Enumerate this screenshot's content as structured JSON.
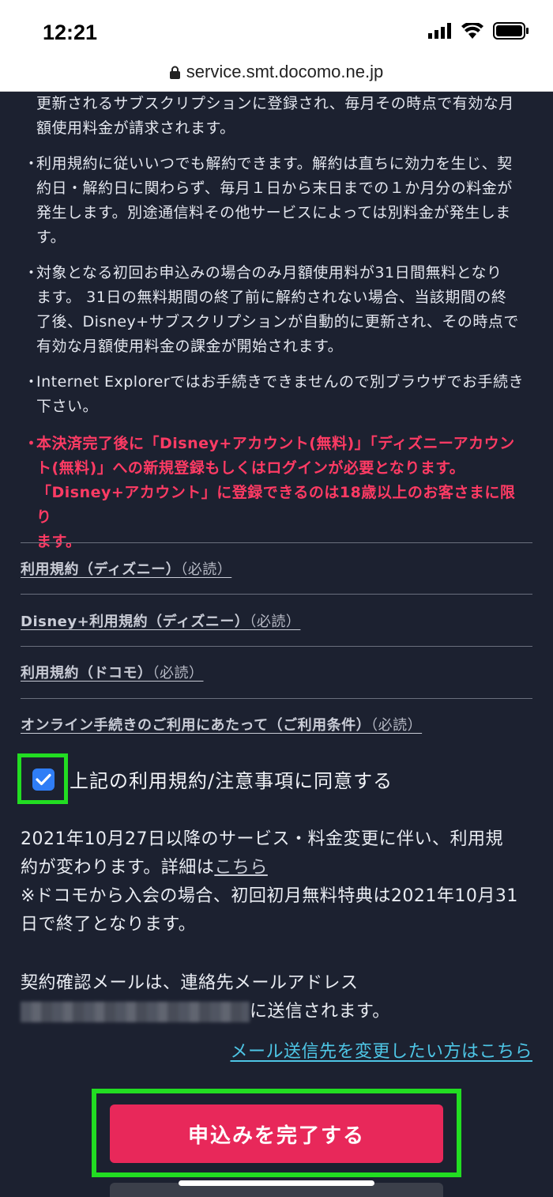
{
  "status_bar": {
    "time": "12:21"
  },
  "browser": {
    "url": "service.smt.docomo.ne.jp"
  },
  "terms_text": {
    "b0_l1": "更新されるサブスクリプションに登録され、毎月その時点で有効な月",
    "b0_l2": "額使用料金が請求されます。",
    "b1_l1": "利用規約に従いいつでも解約できます。解約は直ちに効力を生じ、契",
    "b1_l2": "約日・解約日に関わらず、毎月１日から末日までの１か月分の料金が",
    "b1_l3": "発生します。別途通信料その他サービスによっては別料金が発生しま",
    "b1_l4": "す。",
    "b2_l1": "対象となる初回お申込みの場合のみ月額使用料が31日間無料となり",
    "b2_l2": "ます。 31日の無料期間の終了前に解約されない場合、当該期間の終",
    "b2_l3": "了後、Disney+サブスクリプションが自動的に更新され、その時点で",
    "b2_l4": "有効な月額使用料金の課金が開始されます。",
    "b3_l1": "Internet Explorerではお手続きできませんので別ブラウザでお手続き",
    "b3_l2": "下さい。",
    "b4_l1": "本決済完了後に「Disney+アカウント(無料)」「ディズニーアカウン",
    "b4_l2": "ト(無料)」への新規登録もしくはログインが必要となります。",
    "b4_l3": "「Disney+アカウント」に登録できるのは18歳以上のお客さまに限り",
    "b4_l4": "ます。",
    "bullet_mark": "・"
  },
  "terms_links": [
    {
      "label": "利用規約（ディズニー）",
      "required": "（必読）"
    },
    {
      "label": "Disney+利用規約（ディズニー）",
      "required": "（必読）"
    },
    {
      "label": "利用規約（ドコモ）",
      "required": "（必読）"
    },
    {
      "label": "オンライン手続きのご利用にあたって（ご利用条件）",
      "required": "（必読）"
    }
  ],
  "agreement": {
    "label": "上記の利用規約/注意事項に同意する",
    "checked": true
  },
  "change_notice": {
    "line1": "2021年10月27日以降のサービス・料金変更に伴い、利用規",
    "line2_prefix": "約が変わります。詳細は",
    "line2_link": "こちら",
    "line3": "※ドコモから入会の場合、初回初月無料特典は2021年10月31",
    "line4": "日で終了となります。"
  },
  "email_notice": {
    "line1": "契約確認メールは、連絡先メールアドレス",
    "line2_suffix": "に送信されます。",
    "change_link": "メール送信先を変更したい方はこちら"
  },
  "submit": {
    "label": "申込みを完了する"
  },
  "colors": {
    "accent": "#e8285a",
    "highlight": "#22dd22",
    "link": "#4ec6e6",
    "warning": "#ff3b64"
  }
}
